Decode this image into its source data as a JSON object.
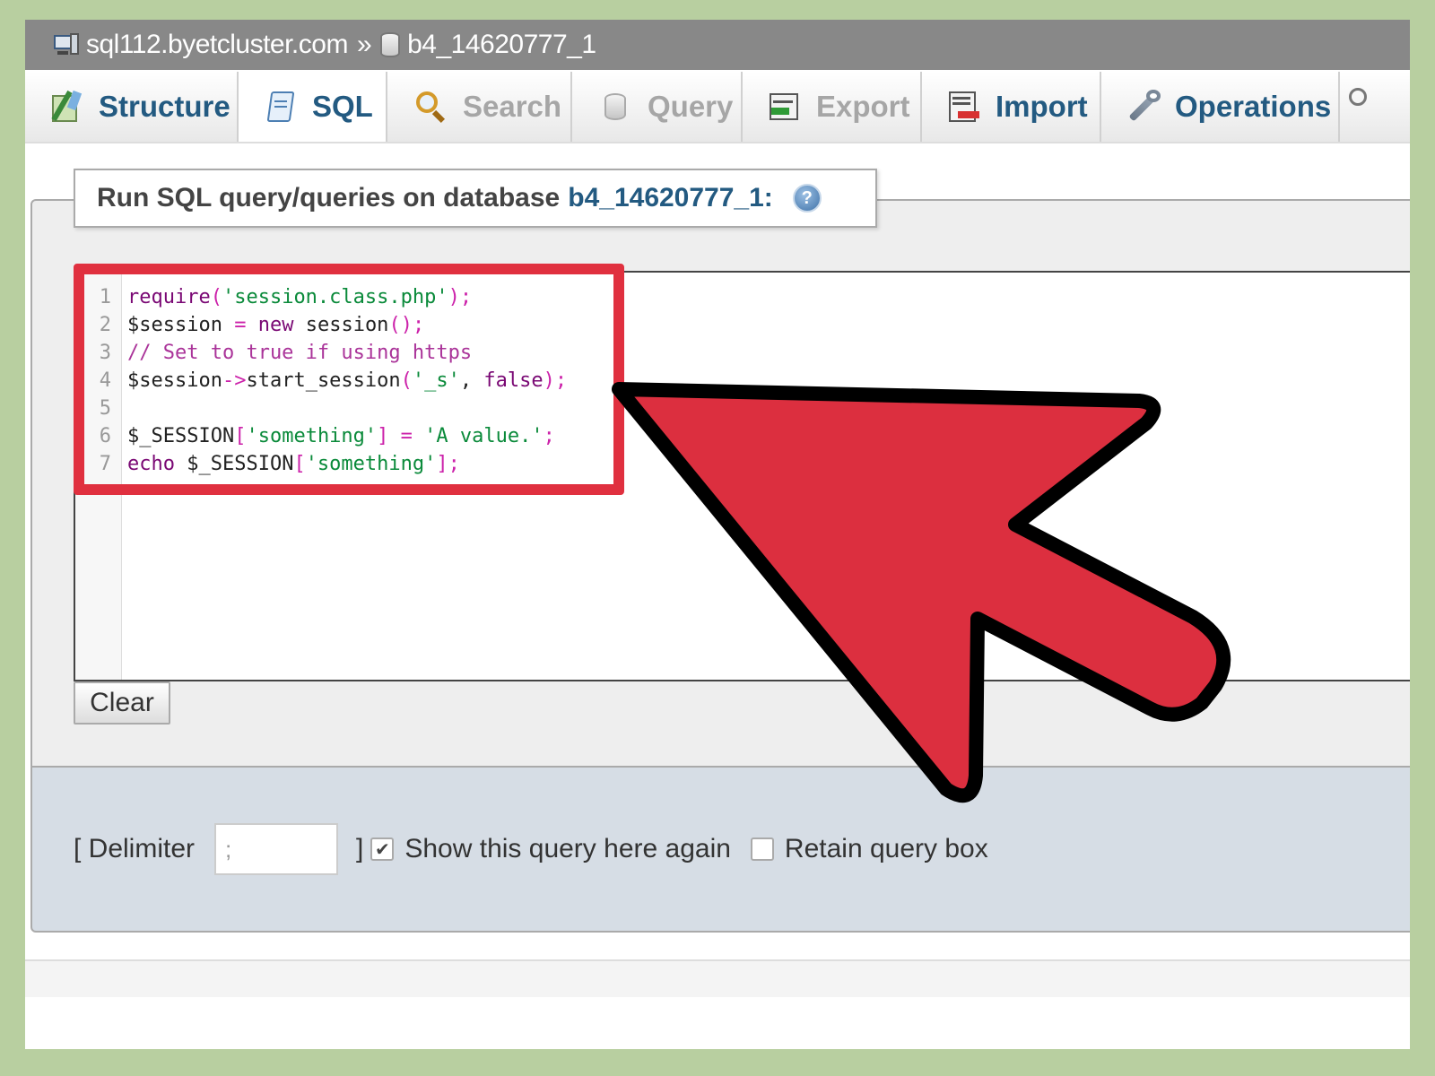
{
  "breadcrumb": {
    "server": "sql112.byetcluster.com",
    "separator": "»",
    "database": "b4_14620777_1",
    "server_icon": "server-icon",
    "database_icon": "database-icon"
  },
  "tabs": [
    {
      "label": "Structure",
      "icon": "structure-icon",
      "state": "enabled"
    },
    {
      "label": "SQL",
      "icon": "sql-icon",
      "state": "active"
    },
    {
      "label": "Search",
      "icon": "search-icon",
      "state": "disabled"
    },
    {
      "label": "Query",
      "icon": "query-icon",
      "state": "disabled"
    },
    {
      "label": "Export",
      "icon": "export-icon",
      "state": "disabled"
    },
    {
      "label": "Import",
      "icon": "import-icon",
      "state": "enabled"
    },
    {
      "label": "Operations",
      "icon": "operations-icon",
      "state": "enabled"
    }
  ],
  "query_panel": {
    "legend_prefix": "Run SQL query/queries on database",
    "legend_database": "b4_14620777_1:",
    "help_icon": "help-icon"
  },
  "editor": {
    "line_numbers": [
      "1",
      "2",
      "3",
      "4",
      "5",
      "6",
      "7"
    ],
    "lines": [
      "require('session.class.php');",
      "$session = new session();",
      "// Set to true if using https",
      "$session->start_session('_s', false);",
      "",
      "$_SESSION['something'] = 'A value.';",
      "echo $_SESSION['something'];"
    ]
  },
  "buttons": {
    "clear": "Clear"
  },
  "options": {
    "delimiter_open": "[ Delimiter",
    "delimiter_value": ";",
    "delimiter_close": "]",
    "show_query_again_label": "Show this query here again",
    "show_query_again_checked": true,
    "retain_query_box_label": "Retain query box",
    "retain_query_box_checked": false
  },
  "colors": {
    "page_background": "#b8cfa0",
    "highlight_red": "#e0303f",
    "link_blue": "#235a81"
  }
}
